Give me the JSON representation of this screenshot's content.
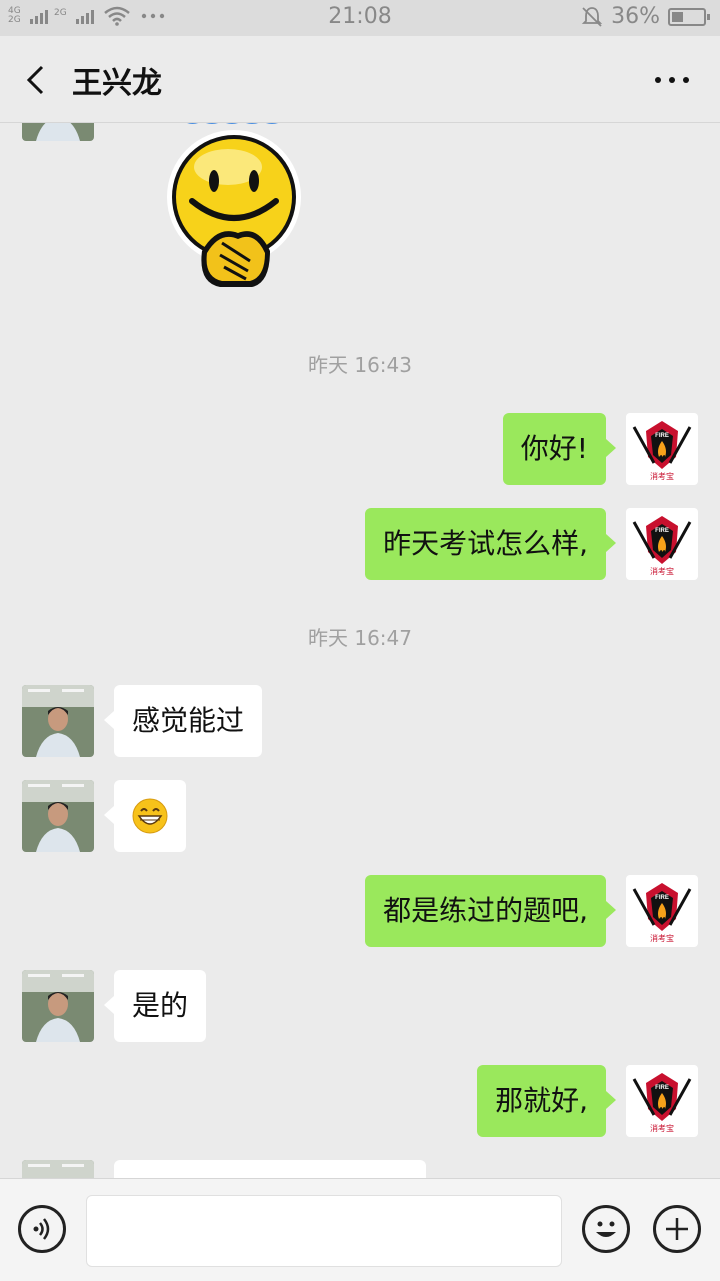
{
  "status_bar": {
    "network_top": "4G",
    "network_bottom": "2G",
    "network2": "2G",
    "time": "21:08",
    "battery_percent": "36%",
    "battery_level": 0.36
  },
  "header": {
    "title": "王兴龙"
  },
  "messages": [
    {
      "type": "time",
      "text": "昨天 16:43"
    },
    {
      "type": "text",
      "from": "me",
      "text": "你好!"
    },
    {
      "type": "text",
      "from": "me",
      "text": "昨天考试怎么样,"
    },
    {
      "type": "time",
      "text": "昨天 16:47"
    },
    {
      "type": "text",
      "from": "them",
      "text": "感觉能过"
    },
    {
      "type": "emoji",
      "from": "them",
      "emoji": "grinning-face"
    },
    {
      "type": "text",
      "from": "me",
      "text": "都是练过的题吧,"
    },
    {
      "type": "text",
      "from": "them",
      "text": "是的"
    },
    {
      "type": "text",
      "from": "me",
      "text": "那就好,"
    }
  ],
  "avatar_me": {
    "badge_text": "消考宝",
    "emblem_text": "FIRE"
  },
  "colors": {
    "my_bubble": "#9ae85c",
    "their_bubble": "#ffffff",
    "background": "#ebebeb"
  }
}
